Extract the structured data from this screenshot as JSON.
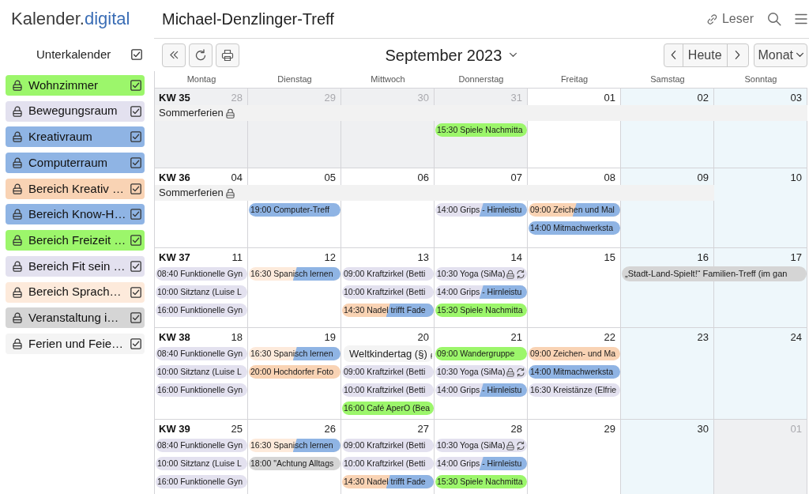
{
  "header": {
    "logo": {
      "wordmark": "Kalender.",
      "accent": "digital"
    },
    "title": "Michael-Denzlinger-Treff",
    "access_label": "Leser"
  },
  "sidebar": {
    "heading": "Unterkalender",
    "all_checked": true,
    "calendars": [
      {
        "label": "Wohnzimmer",
        "color": "#9cf66b",
        "locked": true,
        "checked": true
      },
      {
        "label": "Bewegungsraum",
        "color": "#e3e1ef",
        "locked": true,
        "checked": true
      },
      {
        "label": "Kreativraum",
        "color": "#8fb4e4",
        "locked": true,
        "checked": true
      },
      {
        "label": "Computerraum",
        "color": "#8fb4e4",
        "locked": true,
        "checked": true
      },
      {
        "label": "Bereich Kreativ …",
        "color": "#f9d3b4",
        "locked": true,
        "checked": true
      },
      {
        "label": "Bereich Know-H…",
        "color": "#8fb4e4",
        "locked": true,
        "checked": true
      },
      {
        "label": "Bereich Freizeit …",
        "color": "#9cf66b",
        "locked": true,
        "checked": true
      },
      {
        "label": "Bereich Fit sein …",
        "color": "#e3e1ef",
        "locked": true,
        "checked": true
      },
      {
        "label": "Bereich Sprach…",
        "color": "#fdeadb",
        "locked": true,
        "checked": true
      },
      {
        "label": "Veranstaltung i…",
        "color": "#d5d5d5",
        "locked": true,
        "checked": true
      },
      {
        "label": "Ferien und Feie…",
        "color": "#f4f4f4",
        "locked": true,
        "checked": true
      }
    ]
  },
  "toolbar": {
    "month_label": "September 2023",
    "today_label": "Heute",
    "view_label": "Monat"
  },
  "calendar": {
    "weekdays": [
      "Montag",
      "Dienstag",
      "Mittwoch",
      "Donnerstag",
      "Freitag",
      "Samstag",
      "Sonntag"
    ],
    "weeks": [
      {
        "label": "KW 35",
        "holiday_bars": [
          {
            "label": "Sommerferien",
            "color": "#f2f2f2",
            "locked": true,
            "covers": [
              true,
              true,
              true,
              true,
              true,
              true,
              true
            ]
          }
        ],
        "days": [
          {
            "number": "28",
            "outside_month": true
          },
          {
            "number": "29",
            "outside_month": true
          },
          {
            "number": "30",
            "outside_month": true
          },
          {
            "number": "31",
            "outside_month": true,
            "events": [
              {
                "kind": "timed",
                "label": "15:30 Spiele Nachmitta",
                "color": "#9cf66b",
                "locked": false,
                "repeating": false
              }
            ]
          },
          {
            "number": "01",
            "outside_month": false
          },
          {
            "number": "02",
            "outside_month": false
          },
          {
            "number": "03",
            "outside_month": false
          }
        ]
      },
      {
        "label": "KW 36",
        "holiday_bars": [
          {
            "label": "Sommerferien",
            "color": "#f2f2f2",
            "locked": true,
            "covers": [
              true,
              true,
              true,
              true,
              true,
              true,
              false
            ]
          }
        ],
        "days": [
          {
            "number": "04",
            "outside_month": false
          },
          {
            "number": "05",
            "outside_month": false,
            "events": [
              {
                "kind": "timed",
                "label": "19:00 Computer-Treff",
                "color": "#8fb4e4",
                "locked": false,
                "repeating": false
              }
            ]
          },
          {
            "number": "06",
            "outside_month": false
          },
          {
            "number": "07",
            "outside_month": false,
            "events": [
              {
                "kind": "timed",
                "label": "14:00 Grips - Hirnleistu",
                "color": "#e3e1ef",
                "second_calendar": {
                  "color": "#8fb4e4"
                },
                "locked": false,
                "repeating": false
              }
            ]
          },
          {
            "number": "08",
            "outside_month": false,
            "events": [
              {
                "kind": "timed",
                "label": "09:00 Zeichen und Mal",
                "color": "#f9d3b4",
                "second_calendar": {
                  "color": "#8fb4e4"
                },
                "locked": false,
                "repeating": false
              },
              {
                "kind": "timed",
                "label": "14:00 Mitmachwerksta",
                "color": "#8fb4e4",
                "locked": false,
                "repeating": false
              }
            ]
          },
          {
            "number": "09",
            "outside_month": false
          },
          {
            "number": "10",
            "outside_month": false
          }
        ]
      },
      {
        "label": "KW 37",
        "days": [
          {
            "number": "11",
            "outside_month": false,
            "events": [
              {
                "kind": "timed",
                "label": "08:40 Funktionelle Gyn",
                "color": "#e3e1ef",
                "locked": false,
                "repeating": false
              },
              {
                "kind": "timed",
                "label": "10:00 Sitztanz (Luise L",
                "color": "#e3e1ef",
                "locked": false,
                "repeating": false
              },
              {
                "kind": "timed",
                "label": "16:00 Funktionelle Gyn",
                "color": "#e3e1ef",
                "locked": false,
                "repeating": false
              }
            ]
          },
          {
            "number": "12",
            "outside_month": false,
            "events": [
              {
                "kind": "timed",
                "label": "16:30 Spanisch lernen",
                "color": "#fdeadb",
                "second_calendar": {
                  "color": "#8fb4e4"
                },
                "locked": false,
                "repeating": false
              }
            ]
          },
          {
            "number": "13",
            "outside_month": false,
            "events": [
              {
                "kind": "timed",
                "label": "09:00 Kraftzirkel (Betti",
                "color": "#e3e1ef",
                "locked": false,
                "repeating": false
              },
              {
                "kind": "timed",
                "label": "10:00 Kraftzirkel (Betti",
                "color": "#e3e1ef",
                "locked": false,
                "repeating": false
              },
              {
                "kind": "timed",
                "label": "14:30 Nadel trifft Fade",
                "color": "#f9d3b4",
                "second_calendar": {
                  "color": "#8fb4e4"
                },
                "locked": false,
                "repeating": false
              }
            ]
          },
          {
            "number": "14",
            "outside_month": false,
            "events": [
              {
                "kind": "timed",
                "label": "10:30 Yoga (SiMa)",
                "color": "#e3e1ef",
                "locked": true,
                "repeating": true
              },
              {
                "kind": "timed",
                "label": "14:00 Grips - Hirnleistu",
                "color": "#e3e1ef",
                "second_calendar": {
                  "color": "#8fb4e4"
                },
                "locked": false,
                "repeating": false
              },
              {
                "kind": "timed",
                "label": "15:30 Spiele Nachmitta",
                "color": "#9cf66b",
                "locked": false,
                "repeating": false
              }
            ]
          },
          {
            "number": "15",
            "outside_month": false
          },
          {
            "number": "16",
            "outside_month": false,
            "events": [
              {
                "kind": "multi_day",
                "label": "„Stadt-Land-Spielt!“ Familien-Treff (im gan",
                "color": "#d5d5d5",
                "continues": true
              }
            ]
          },
          {
            "number": "17",
            "outside_month": false
          }
        ]
      },
      {
        "label": "KW 38",
        "days": [
          {
            "number": "18",
            "outside_month": false,
            "events": [
              {
                "kind": "timed",
                "label": "08:40 Funktionelle Gyn",
                "color": "#e3e1ef",
                "locked": false,
                "repeating": false
              },
              {
                "kind": "timed",
                "label": "10:00 Sitztanz (Luise L",
                "color": "#e3e1ef",
                "locked": false,
                "repeating": false
              },
              {
                "kind": "timed",
                "label": "16:00 Funktionelle Gyn",
                "color": "#e3e1ef",
                "locked": false,
                "repeating": false
              }
            ]
          },
          {
            "number": "19",
            "outside_month": false,
            "events": [
              {
                "kind": "timed",
                "label": "16:30 Spanisch lernen",
                "color": "#fdeadb",
                "second_calendar": {
                  "color": "#8fb4e4"
                },
                "locked": false,
                "repeating": false
              },
              {
                "kind": "timed",
                "label": "20:00 Hochdorfer Foto",
                "color": "#f9d3b4",
                "locked": false,
                "repeating": false
              }
            ]
          },
          {
            "number": "20",
            "outside_month": false,
            "events": [
              {
                "kind": "all_day",
                "label": "Weltkindertag (§)",
                "color": "#f4f4f4",
                "locked": true,
                "repeating": false
              },
              {
                "kind": "timed",
                "label": "09:00 Kraftzirkel (Betti",
                "color": "#e3e1ef",
                "locked": false,
                "repeating": false
              },
              {
                "kind": "timed",
                "label": "10:00 Kraftzirkel (Betti",
                "color": "#e3e1ef",
                "locked": false,
                "repeating": false
              },
              {
                "kind": "timed",
                "label": "16:00 Café AperO (Bea",
                "color": "#9cf66b",
                "locked": false,
                "repeating": false
              }
            ]
          },
          {
            "number": "21",
            "outside_month": false,
            "events": [
              {
                "kind": "timed",
                "label": "09:00 Wandergruppe",
                "color": "#9cf66b",
                "locked": false,
                "repeating": false
              },
              {
                "kind": "timed",
                "label": "10:30 Yoga (SiMa)",
                "color": "#e3e1ef",
                "locked": true,
                "repeating": true
              },
              {
                "kind": "timed",
                "label": "14:00 Grips - Hirnleistu",
                "color": "#e3e1ef",
                "second_calendar": {
                  "color": "#8fb4e4"
                },
                "locked": false,
                "repeating": false
              }
            ]
          },
          {
            "number": "22",
            "outside_month": false,
            "events": [
              {
                "kind": "timed",
                "label": "09:00 Zeichen- und Ma",
                "color": "#f9d3b4",
                "locked": false,
                "repeating": false
              },
              {
                "kind": "timed",
                "label": "14:00 Mitmachwerksta",
                "color": "#8fb4e4",
                "locked": false,
                "repeating": false
              },
              {
                "kind": "timed",
                "label": "16:30 Kreistänze (Elfrie",
                "color": "#e3e1ef",
                "locked": false,
                "repeating": false
              }
            ]
          },
          {
            "number": "23",
            "outside_month": false
          },
          {
            "number": "24",
            "outside_month": false
          }
        ]
      },
      {
        "label": "KW 39",
        "days": [
          {
            "number": "25",
            "outside_month": false,
            "events": [
              {
                "kind": "timed",
                "label": "08:40 Funktionelle Gyn",
                "color": "#e3e1ef",
                "locked": false,
                "repeating": false
              },
              {
                "kind": "timed",
                "label": "10:00 Sitztanz (Luise L",
                "color": "#e3e1ef",
                "locked": false,
                "repeating": false
              },
              {
                "kind": "timed",
                "label": "16:00 Funktionelle Gyn",
                "color": "#e3e1ef",
                "locked": false,
                "repeating": false
              }
            ]
          },
          {
            "number": "26",
            "outside_month": false,
            "events": [
              {
                "kind": "timed",
                "label": "16:30 Spanisch lernen",
                "color": "#fdeadb",
                "second_calendar": {
                  "color": "#8fb4e4"
                },
                "locked": false,
                "repeating": false
              },
              {
                "kind": "timed",
                "label": "18:00 \"Achtung Alltags",
                "color": "#d5d5d5",
                "locked": false,
                "repeating": false
              }
            ]
          },
          {
            "number": "27",
            "outside_month": false,
            "events": [
              {
                "kind": "timed",
                "label": "09:00 Kraftzirkel (Betti",
                "color": "#e3e1ef",
                "locked": false,
                "repeating": false
              },
              {
                "kind": "timed",
                "label": "10:00 Kraftzirkel (Betti",
                "color": "#e3e1ef",
                "locked": false,
                "repeating": false
              },
              {
                "kind": "timed",
                "label": "14:30 Nadel trifft Fade",
                "color": "#f9d3b4",
                "second_calendar": {
                  "color": "#8fb4e4"
                },
                "locked": false,
                "repeating": false
              }
            ]
          },
          {
            "number": "28",
            "outside_month": false,
            "events": [
              {
                "kind": "timed",
                "label": "10:30 Yoga (SiMa)",
                "color": "#e3e1ef",
                "locked": true,
                "repeating": true
              },
              {
                "kind": "timed",
                "label": "14:00 Grips - Hirnleistu",
                "color": "#e3e1ef",
                "second_calendar": {
                  "color": "#8fb4e4"
                },
                "locked": false,
                "repeating": false
              },
              {
                "kind": "timed",
                "label": "15:30 Spiele Nachmitta",
                "color": "#9cf66b",
                "locked": false,
                "repeating": false
              }
            ]
          },
          {
            "number": "29",
            "outside_month": false
          },
          {
            "number": "30",
            "outside_month": false
          },
          {
            "number": "01",
            "outside_month": true
          }
        ]
      }
    ]
  }
}
